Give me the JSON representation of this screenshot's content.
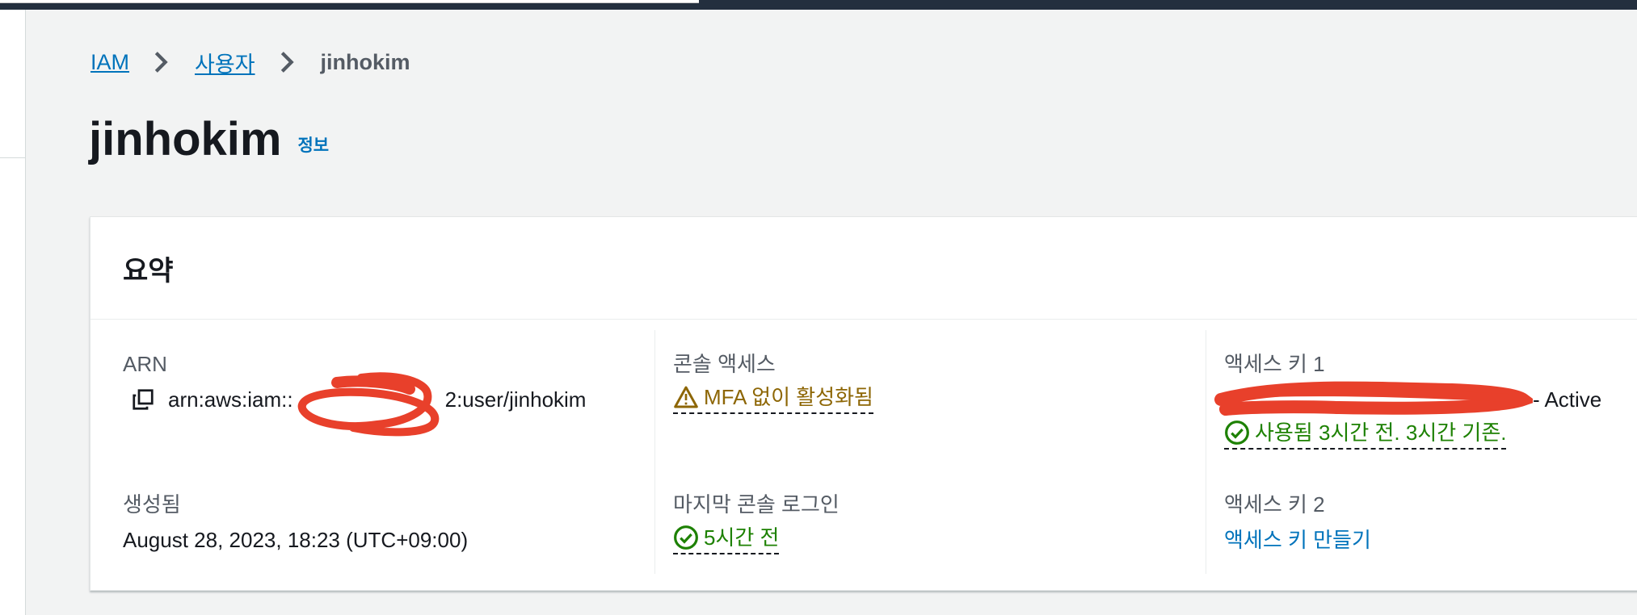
{
  "breadcrumb": {
    "items": [
      "IAM",
      "사용자"
    ],
    "current": "jinhokim"
  },
  "page": {
    "title": "jinhokim",
    "info_link": "정보"
  },
  "summary": {
    "title": "요약",
    "arn": {
      "label": "ARN",
      "value_prefix": "arn:aws:iam::",
      "value_suffix": "2:user/jinhokim"
    },
    "created": {
      "label": "생성됨",
      "value": "August 28, 2023, 18:23 (UTC+09:00)"
    },
    "console_access": {
      "label": "콘솔 액세스",
      "status": "MFA 없이 활성화됨"
    },
    "last_console_login": {
      "label": "마지막 콘솔 로그인",
      "status": "5시간 전"
    },
    "access_key_1": {
      "label": "액세스 키 1",
      "state": "- Active",
      "usage": "사용됨 3시간 전. 3시간 기존."
    },
    "access_key_2": {
      "label": "액세스 키 2",
      "action": "액세스 키 만들기"
    }
  },
  "colors": {
    "link": "#0073bb",
    "warning": "#8d6605",
    "success": "#1d8102",
    "redaction": "#e8402b",
    "topbar": "#232f3e"
  },
  "icons": {
    "copy": "copy-icon",
    "warning": "warning-icon",
    "success": "check-circle-icon",
    "separator": "chevron-right-icon"
  }
}
